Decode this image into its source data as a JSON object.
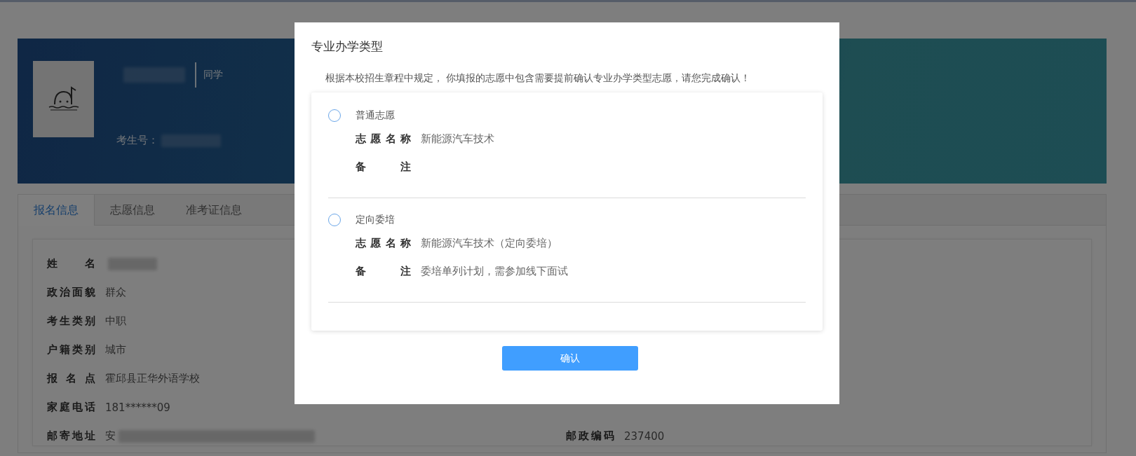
{
  "banner": {
    "greeting": "同学",
    "exam_number_label": "考生号："
  },
  "tabs": [
    {
      "label": "报名信息",
      "selected": true
    },
    {
      "label": "志愿信息",
      "selected": false
    },
    {
      "label": "准考证信息",
      "selected": false
    }
  ],
  "info_left": [
    {
      "label": "姓名",
      "blurred": true
    },
    {
      "label": "政治面貌",
      "value": "群众",
      "blurred": false
    },
    {
      "label": "考生类别",
      "value": "中职",
      "blurred": false
    },
    {
      "label": "户籍类别",
      "value": "城市",
      "blurred": false
    },
    {
      "label": "报名点",
      "value": "霍邱县正华外语学校",
      "blurred": false
    },
    {
      "label": "家庭电话",
      "value": "181******09",
      "blurred": false
    },
    {
      "label": "邮寄地址",
      "value": "安",
      "blurred": true
    }
  ],
  "info_right": [
    {
      "label": "邮政编码",
      "value": "237400",
      "blurred": false
    }
  ],
  "modal": {
    "title": "专业办学类型",
    "message": "根据本校招生章程中规定， 你填报的志愿中包含需要提前确认专业办学类型志愿，请您完成确认！",
    "options": [
      {
        "label": "普通志愿",
        "selected": false,
        "fields": [
          {
            "label": "志愿名称",
            "value": "新能源汽车技术"
          },
          {
            "label": "备注"
          }
        ]
      },
      {
        "label": "定向委培",
        "selected": false,
        "fields": [
          {
            "label": "志愿名称",
            "value": "新能源汽车技术（定向委培）"
          },
          {
            "label": "备注",
            "value": "委培单列计划，需参加线下面试"
          }
        ]
      }
    ],
    "confirm_button": "确认"
  }
}
